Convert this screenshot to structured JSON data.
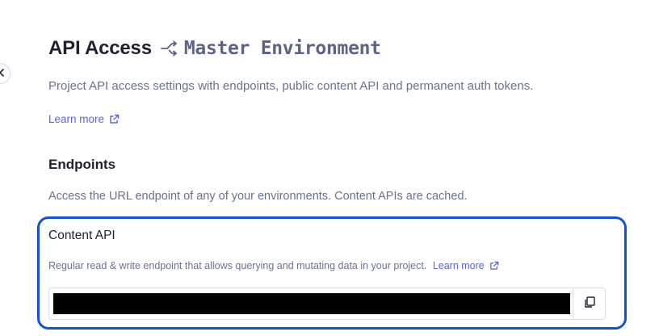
{
  "header": {
    "title": "API Access",
    "environment": "Master Environment",
    "description": "Project API access settings with endpoints, public content API and permanent auth tokens.",
    "learn_more": "Learn more"
  },
  "endpoints": {
    "title": "Endpoints",
    "description": "Access the URL endpoint of any of your environments. Content APIs are cached."
  },
  "content_api": {
    "title": "Content API",
    "description": "Regular read & write endpoint that allows querying and mutating data in your project.",
    "learn_more": "Learn more",
    "endpoint_value": ""
  },
  "icons": {
    "collapse": "chevron-left-icon",
    "branch": "branch-icon",
    "external": "external-link-icon",
    "copy": "copy-icon"
  },
  "colors": {
    "accent": "#5b63d3",
    "highlight_border": "#1450d8",
    "muted_text": "#6b7191",
    "heading": "#1f2133"
  }
}
